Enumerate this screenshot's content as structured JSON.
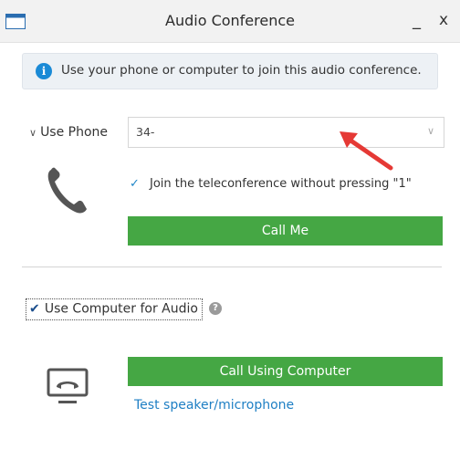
{
  "window": {
    "title": "Audio Conference",
    "minimize_glyph": "_",
    "close_glyph": "x"
  },
  "info": {
    "icon": "info-icon",
    "text": "Use your phone or computer to join this audio conference."
  },
  "phone_section": {
    "toggle_label": "Use Phone",
    "phone_value": "34-",
    "join_checked": true,
    "join_label": "Join the teleconference without pressing \"1\"",
    "call_me_label": "Call Me"
  },
  "computer_section": {
    "checkbox_label": "Use Computer for Audio",
    "checked": true,
    "call_button_label": "Call Using Computer",
    "test_link": "Test speaker/microphone"
  },
  "colors": {
    "button_green": "#45a744",
    "link_blue": "#1e7fc4",
    "info_blue": "#1a8ad6",
    "annotation_red": "#e53935"
  }
}
